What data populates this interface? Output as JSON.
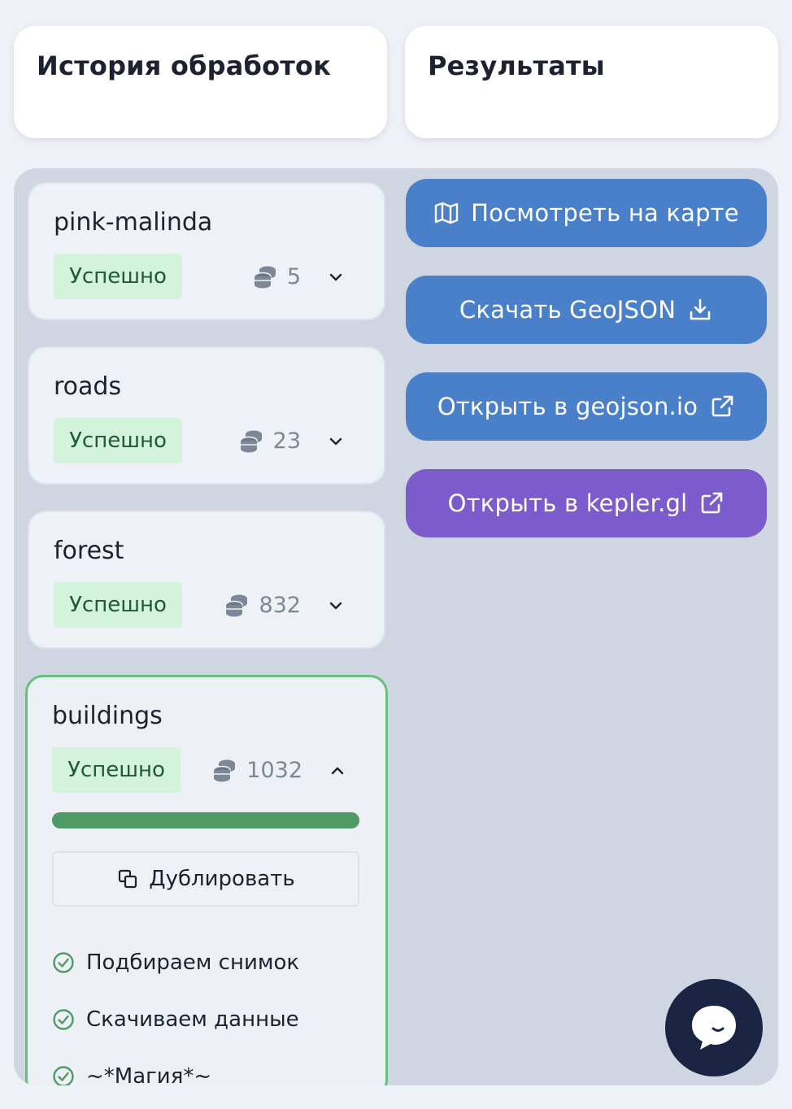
{
  "header": {
    "history_title": "История обработок",
    "results_title": "Результаты"
  },
  "history": [
    {
      "name": "pink-malinda",
      "status": "Успешно",
      "count": "5",
      "expanded": false
    },
    {
      "name": "roads",
      "status": "Успешно",
      "count": "23",
      "expanded": false
    },
    {
      "name": "forest",
      "status": "Успешно",
      "count": "832",
      "expanded": false
    },
    {
      "name": "buildings",
      "status": "Успешно",
      "count": "1032",
      "expanded": true,
      "progress": 1.0,
      "duplicate_label": "Дублировать",
      "steps": [
        "Подбираем снимок",
        "Скачиваем данные",
        "~*Магия*~"
      ]
    }
  ],
  "actions": {
    "view_map": "Посмотреть на карте",
    "download": "Скачать GeoJSON",
    "open_geojson": "Открыть в geojson.io",
    "open_kepler": "Открыть в kepler.gl"
  },
  "colors": {
    "accent_blue": "#4a80c9",
    "accent_purple": "#7c5ccc",
    "success_bg": "#d4f3dc",
    "progress": "#4f9a66",
    "active_border": "#66c07f"
  },
  "icons": {
    "coins": "coins-icon",
    "chevron_down": "chevron-down-icon",
    "chevron_up": "chevron-up-icon",
    "map": "map-icon",
    "download": "download-icon",
    "external": "external-link-icon",
    "copy": "copy-icon",
    "check": "check-circle-icon",
    "chat": "chat-icon"
  }
}
